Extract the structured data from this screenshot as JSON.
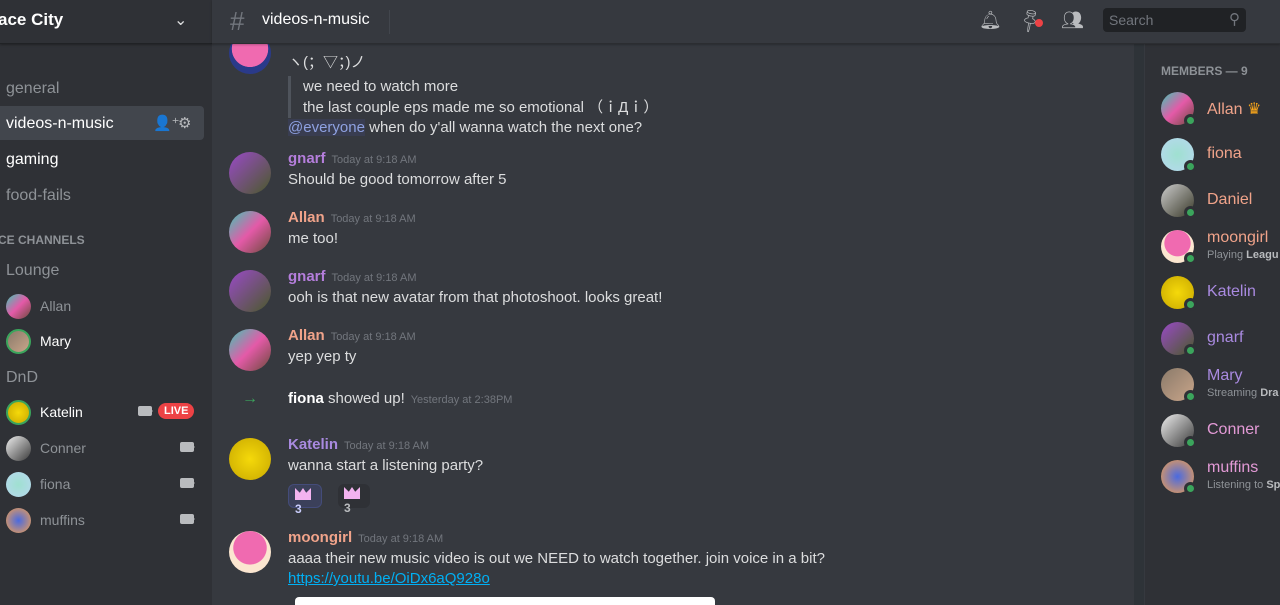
{
  "server": {
    "name": "ace City"
  },
  "channels": [
    {
      "label": "general",
      "state": "muted"
    },
    {
      "label": "videos-n-music",
      "state": "active"
    },
    {
      "label": "gaming",
      "state": "unread"
    },
    {
      "label": "food-fails",
      "state": "muted"
    }
  ],
  "voice": {
    "category": "CE CHANNELS",
    "rooms": [
      {
        "name": "Lounge",
        "users": [
          {
            "name": "Allan",
            "speaking": false
          },
          {
            "name": "Mary",
            "speaking": true
          }
        ]
      },
      {
        "name": "DnD",
        "users": [
          {
            "name": "Katelin",
            "speaking": true,
            "video": true,
            "live": "LIVE"
          },
          {
            "name": "Conner",
            "video": true
          },
          {
            "name": "fiona",
            "video": true
          },
          {
            "name": "muffins",
            "video": true
          }
        ]
      }
    ]
  },
  "header": {
    "channel": "videos-n-music",
    "search_placeholder": "Search",
    "icons": [
      "bell-icon",
      "pin-icon",
      "members-icon",
      "search-icon"
    ]
  },
  "messages": {
    "top": {
      "kaomoji": "ヽ(；▽；)ノ",
      "quote": [
        "we need to watch more",
        "the last couple eps made me so emotional （ｉДｉ）"
      ],
      "mention": "@everyone",
      "text": " when do y'all wanna watch the next one?"
    },
    "list": [
      {
        "user": "gnarf",
        "color": "#b57edc",
        "time": "Today at 9:18 AM",
        "text": "Should be good tomorrow after 5"
      },
      {
        "user": "Allan",
        "color": "#f0a38a",
        "time": "Today at 9:18 AM",
        "text": "me too!"
      },
      {
        "user": "gnarf",
        "color": "#b57edc",
        "time": "Today at 9:18 AM",
        "text": "ooh is that new avatar from that photoshoot. looks great!"
      },
      {
        "user": "Allan",
        "color": "#f0a38a",
        "time": "Today at 9:18 AM",
        "text": "yep yep ty"
      }
    ],
    "join": {
      "user": "fiona",
      "text": " showed up!",
      "time": "Yesterday at 2:38PM"
    },
    "katelin": {
      "user": "Katelin",
      "color": "#a98ae0",
      "time": "Today at 9:18 AM",
      "text": "wanna start a listening party?",
      "reactions": [
        {
          "count": "3",
          "mine": true
        },
        {
          "count": "3",
          "mine": false
        }
      ]
    },
    "moongirl": {
      "user": "moongirl",
      "color": "#f0a38a",
      "time": "Today at 9:18 AM",
      "text": "aaaa their new music video is out we NEED to watch together. join voice in a bit?",
      "link": "https://youtu.be/OiDx6aQ928o"
    }
  },
  "members": {
    "header": "MEMBERS — 9",
    "list": [
      {
        "name": "Allan",
        "color": "#f0a38a",
        "crown": true
      },
      {
        "name": "fiona",
        "color": "#f0a38a"
      },
      {
        "name": "Daniel",
        "color": "#f0a38a"
      },
      {
        "name": "moongirl",
        "color": "#f0a38a",
        "activity": "Playing ",
        "activity_bold": "Leagu"
      },
      {
        "name": "Katelin",
        "color": "#a98ae0"
      },
      {
        "name": "gnarf",
        "color": "#a98ae0"
      },
      {
        "name": "Mary",
        "color": "#a98ae0",
        "activity": "Streaming ",
        "activity_bold": "Dra"
      },
      {
        "name": "Conner",
        "color": "#e39ad6"
      },
      {
        "name": "muffins",
        "color": "#e39ad6",
        "activity": "Listening to ",
        "activity_bold": "Sp"
      }
    ]
  },
  "colors": {
    "accent": "#5865f2",
    "online": "#3ba55c",
    "live": "#ed4245",
    "link": "#00b0f4"
  }
}
